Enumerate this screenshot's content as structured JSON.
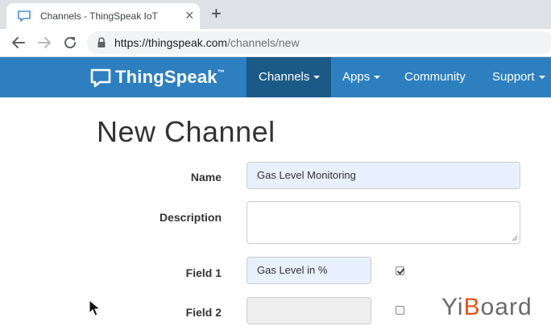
{
  "browser": {
    "tab_title": "Channels - ThingSpeak IoT",
    "tab_close": "×",
    "new_tab": "+",
    "url_host": "https://thingspeak.com",
    "url_path": "/channels/new"
  },
  "navbar": {
    "brand": "ThingSpeak",
    "brand_tm": "™",
    "items": [
      {
        "label": "Channels",
        "active": true,
        "dropdown": true
      },
      {
        "label": "Apps",
        "active": false,
        "dropdown": true
      },
      {
        "label": "Community",
        "active": false,
        "dropdown": false
      },
      {
        "label": "Support",
        "active": false,
        "dropdown": true
      }
    ]
  },
  "page": {
    "title": "New Channel"
  },
  "form": {
    "name_label": "Name",
    "name_value": "Gas Level Monitoring",
    "description_label": "Description",
    "description_value": "",
    "field1_label": "Field 1",
    "field1_value": "Gas Level in %",
    "field1_checked": true,
    "field2_label": "Field 2",
    "field2_value": "",
    "field2_checked": false
  },
  "watermark": {
    "prefix": "Yi",
    "accent": "B",
    "suffix": "oard"
  },
  "colors": {
    "navbar": "#2d7fbf",
    "navbar_active": "#1b5a87",
    "autofill": "#e8f0fe",
    "watermark_accent": "#e0541e"
  }
}
